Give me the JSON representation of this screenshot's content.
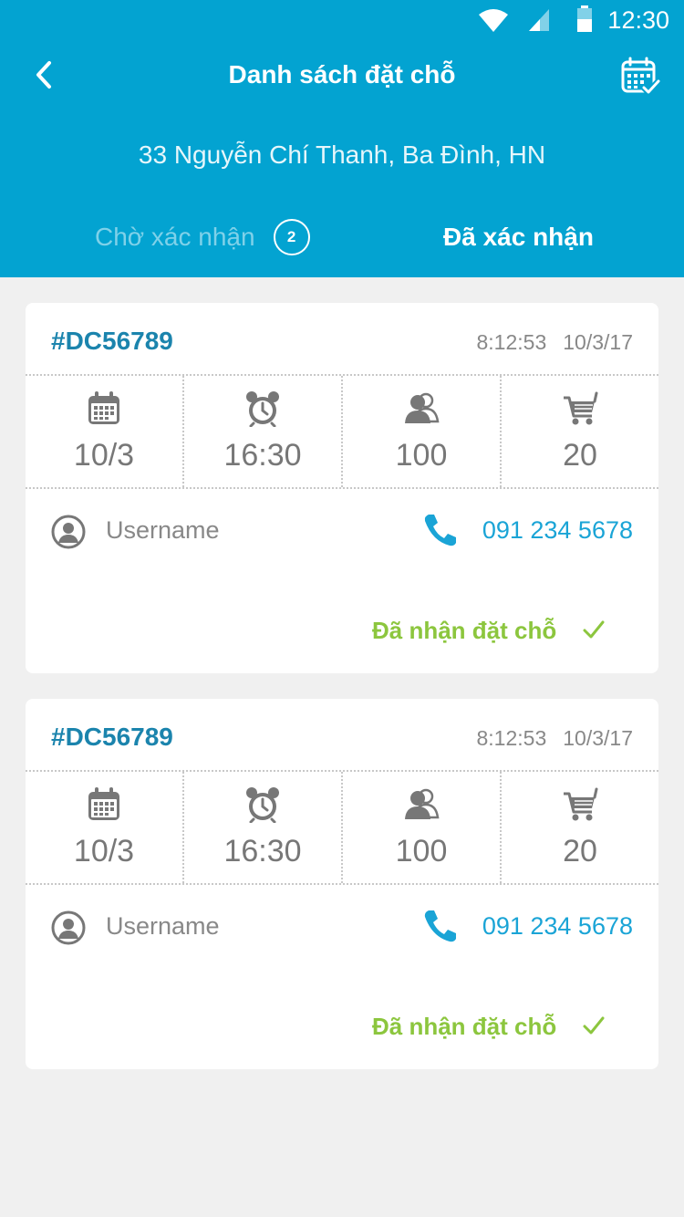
{
  "status_bar": {
    "time": "12:30"
  },
  "header": {
    "title": "Danh sách đặt chỗ",
    "address": "33 Nguyễn Chí Thanh, Ba Đình, HN",
    "tabs": [
      {
        "label": "Chờ xác nhận",
        "badge": "2",
        "active": false
      },
      {
        "label": "Đã xác nhận",
        "active": true
      }
    ]
  },
  "bookings": [
    {
      "id": "#DC56789",
      "time": "8:12:53",
      "date": "10/3/17",
      "stats": {
        "date": "10/3",
        "hour": "16:30",
        "people": "100",
        "items": "20"
      },
      "username": "Username",
      "phone": "091 234 5678",
      "status": "Đã nhận đặt chỗ"
    },
    {
      "id": "#DC56789",
      "time": "8:12:53",
      "date": "10/3/17",
      "stats": {
        "date": "10/3",
        "hour": "16:30",
        "people": "100",
        "items": "20"
      },
      "username": "Username",
      "phone": "091 234 5678",
      "status": "Đã nhận đặt chỗ"
    }
  ],
  "colors": {
    "header": "#03a3d1",
    "booking_id": "#1b84ad",
    "phone": "#1aa4d6",
    "status_ok": "#8cc63e"
  },
  "icons": [
    "back-arrow-icon",
    "calendar-check-icon",
    "wifi-icon",
    "signal-icon",
    "battery-icon",
    "calendar-icon",
    "alarm-clock-icon",
    "people-icon",
    "cart-icon",
    "user-icon",
    "phone-icon",
    "check-icon"
  ]
}
